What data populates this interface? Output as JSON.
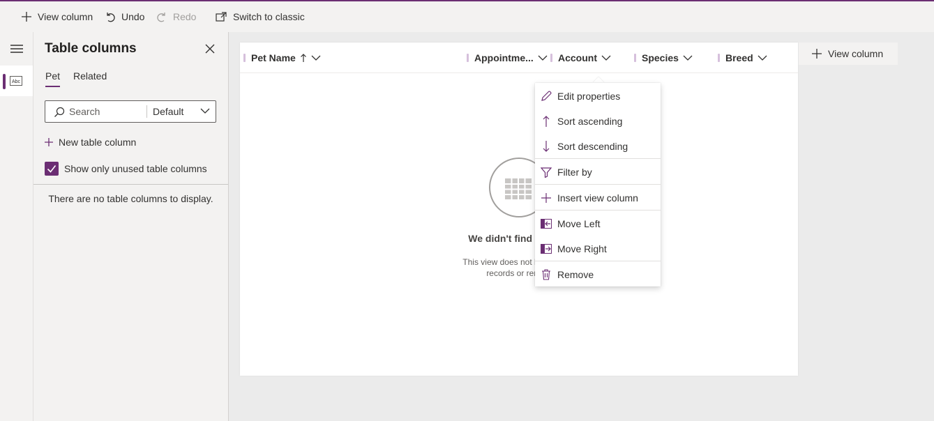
{
  "toolbar": {
    "view_column_label": "View column",
    "undo_label": "Undo",
    "redo_label": "Redo",
    "switch_label": "Switch to classic"
  },
  "rail": {
    "active_item_icon": "Abc"
  },
  "panel": {
    "title": "Table columns",
    "tabs": [
      {
        "label": "Pet",
        "active": true
      },
      {
        "label": "Related",
        "active": false
      }
    ],
    "search_placeholder": "Search",
    "filter_value": "Default",
    "new_column_label": "New table column",
    "checkbox_label": "Show only unused table columns",
    "checkbox_checked": true,
    "empty_message": "There are no table columns to display."
  },
  "grid": {
    "columns": [
      {
        "label": "Pet Name",
        "sorted": "ascending"
      },
      {
        "label": "Appointme..."
      },
      {
        "label": "Account"
      },
      {
        "label": "Species"
      },
      {
        "label": "Breed"
      }
    ],
    "empty_title": "We didn't find anythin",
    "empty_desc_line1": "This view does not have any d",
    "empty_desc_line2": "records or removi"
  },
  "add_view_column_label": "View column",
  "context_menu": {
    "items": [
      {
        "label": "Edit properties",
        "icon": "pencil-icon"
      },
      {
        "label": "Sort ascending",
        "icon": "arrow-up-icon"
      },
      {
        "label": "Sort descending",
        "icon": "arrow-down-icon"
      },
      {
        "label": "Filter by",
        "icon": "filter-icon"
      },
      {
        "label": "Insert view column",
        "icon": "plus-icon"
      },
      {
        "label": "Move Left",
        "icon": "move-left-icon"
      },
      {
        "label": "Move Right",
        "icon": "move-right-icon"
      },
      {
        "label": "Remove",
        "icon": "trash-icon"
      }
    ]
  },
  "colors": {
    "accent": "#6b2e73",
    "toolbar_bg": "#f3f2f1",
    "canvas_bg": "#ebebeb"
  }
}
